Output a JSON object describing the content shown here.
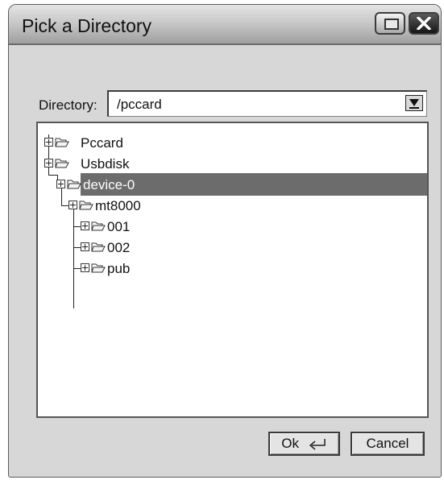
{
  "window": {
    "title": "Pick a Directory",
    "maximize_icon": "maximize-icon",
    "close_icon": "close-icon"
  },
  "directory": {
    "label": "Directory:",
    "value": "/pccard"
  },
  "tree": {
    "items": [
      {
        "label": "Pccard",
        "level": 0,
        "selected": false
      },
      {
        "label": "Usbdisk",
        "level": 0,
        "selected": false
      },
      {
        "label": "device-0",
        "level": 1,
        "selected": true
      },
      {
        "label": "mt8000",
        "level": 2,
        "selected": false
      },
      {
        "label": "001",
        "level": 3,
        "selected": false
      },
      {
        "label": "002",
        "level": 3,
        "selected": false
      },
      {
        "label": "pub",
        "level": 3,
        "selected": false
      }
    ]
  },
  "buttons": {
    "ok_label": "Ok",
    "cancel_label": "Cancel"
  },
  "colors": {
    "selection": "#6c6c6c",
    "dialog_bg": "#d7d7d7"
  }
}
